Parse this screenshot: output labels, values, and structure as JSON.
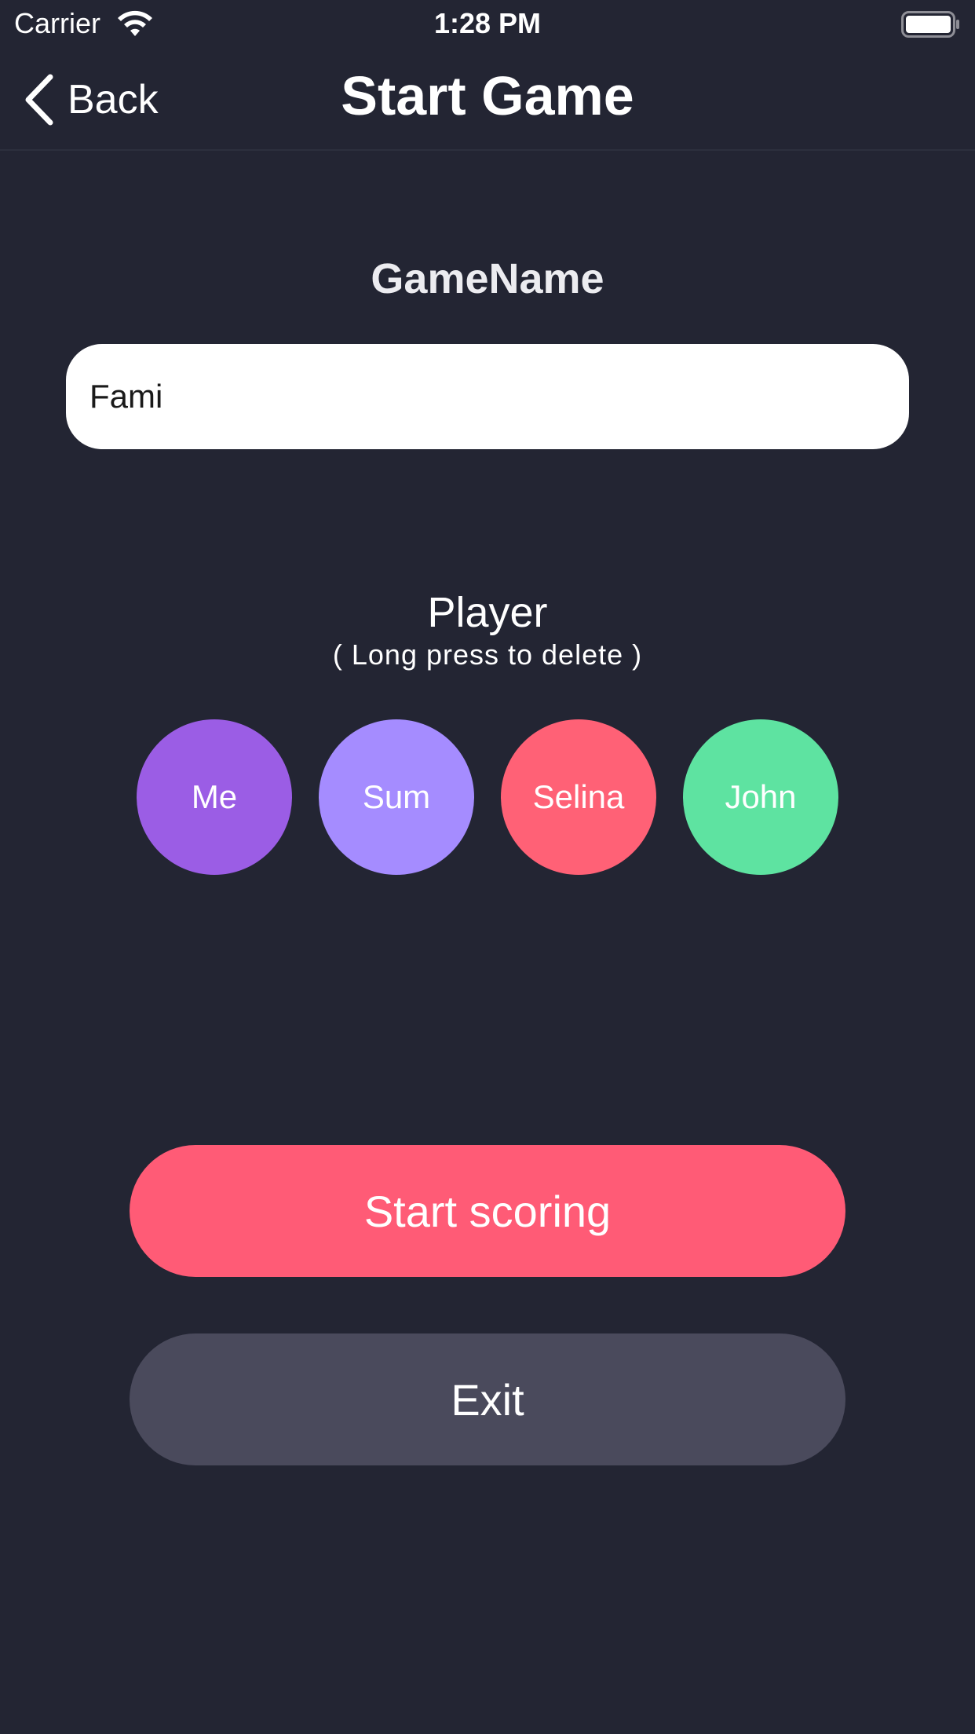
{
  "status_bar": {
    "carrier": "Carrier",
    "time": "1:28 PM",
    "icons": [
      "wifi-icon",
      "battery-icon"
    ]
  },
  "nav": {
    "back_label": "Back",
    "title": "Start Game",
    "back_icon": "chevron-left-icon"
  },
  "game": {
    "label": "GameName",
    "value": "Fami"
  },
  "players_section": {
    "title": "Player",
    "hint": "( Long press to delete )",
    "players": [
      {
        "name": "Me",
        "color": "#9b5de5"
      },
      {
        "name": "Sum",
        "color": "#a58cff"
      },
      {
        "name": "Selina",
        "color": "#ff6176"
      },
      {
        "name": "John",
        "color": "#5ee3a1"
      }
    ]
  },
  "actions": {
    "start_label": "Start scoring",
    "exit_label": "Exit",
    "start_color": "#ff5b76",
    "exit_color": "#4a4a5c"
  },
  "theme": {
    "background": "#232533"
  }
}
